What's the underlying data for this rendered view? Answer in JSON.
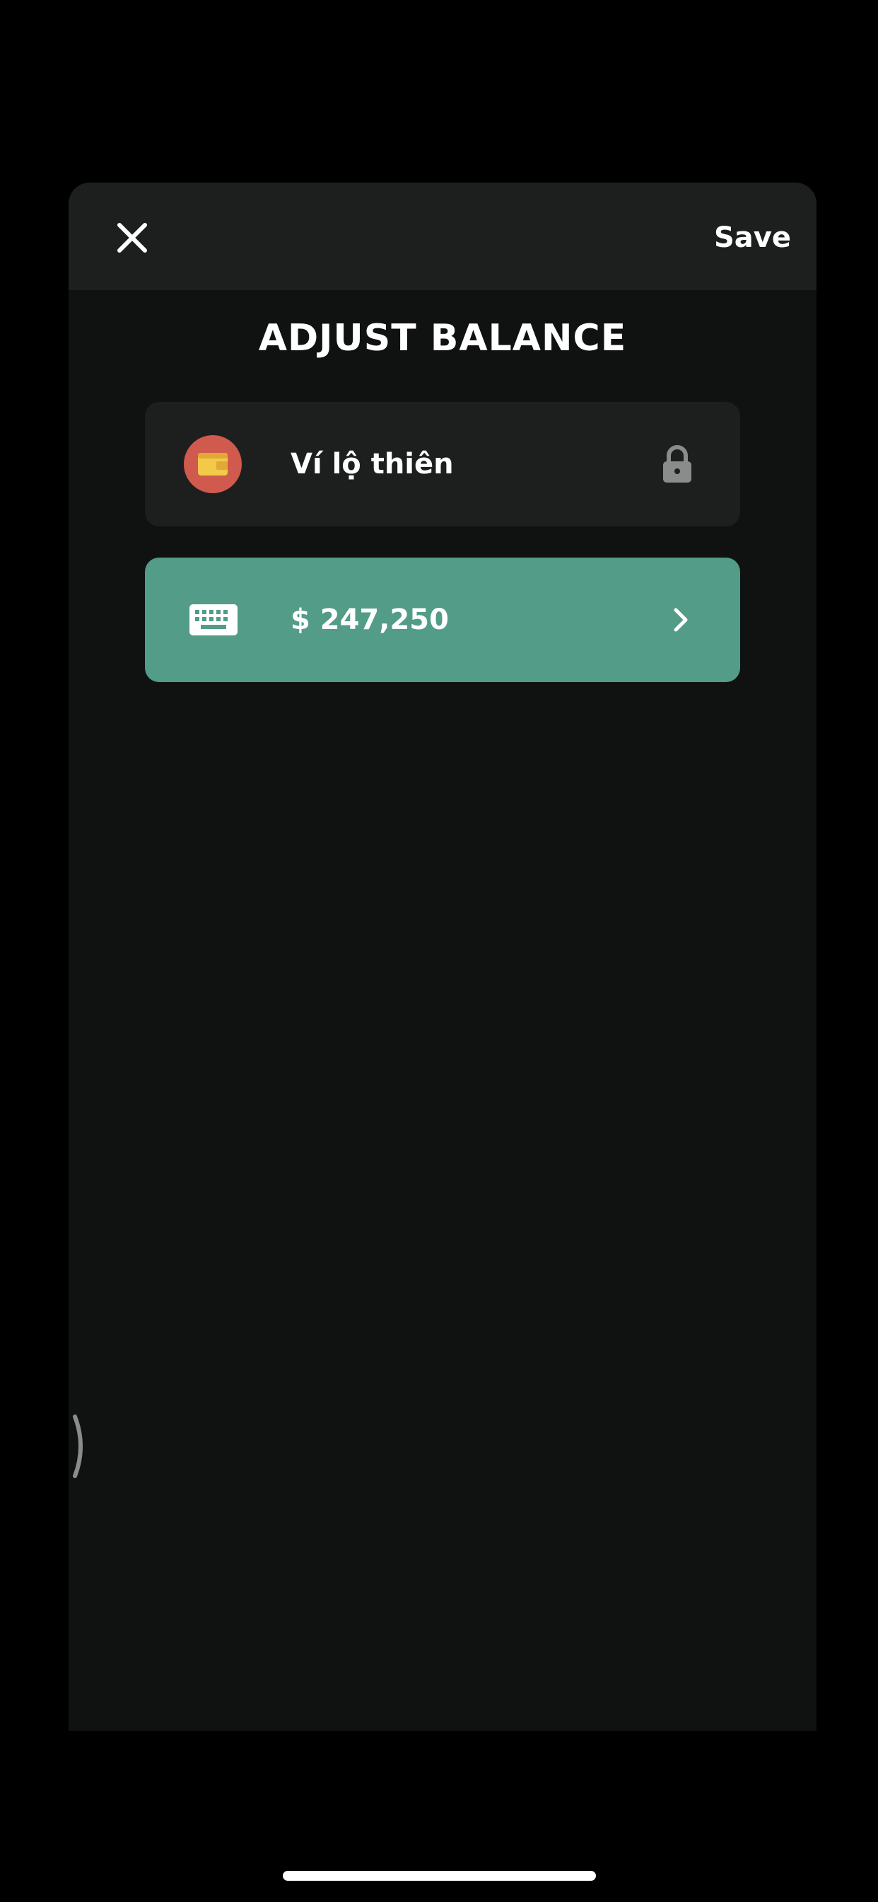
{
  "header": {
    "close_icon": "close-icon",
    "save_label": "Save"
  },
  "title": "ADJUST BALANCE",
  "wallet": {
    "icon": "wallet-icon",
    "name": "Ví lộ thiên",
    "lock_icon": "lock-icon"
  },
  "balance": {
    "icon": "keyboard-icon",
    "value": "$ 247,250",
    "chevron_icon": "chevron-right-icon"
  },
  "colors": {
    "background": "#000000",
    "sheet": "#101111",
    "header": "#1d1f1f",
    "card": "#1d1f1f",
    "accent": "#529c88",
    "wallet_badge": "#d05a4e",
    "wallet_yellow": "#f3c94a"
  }
}
